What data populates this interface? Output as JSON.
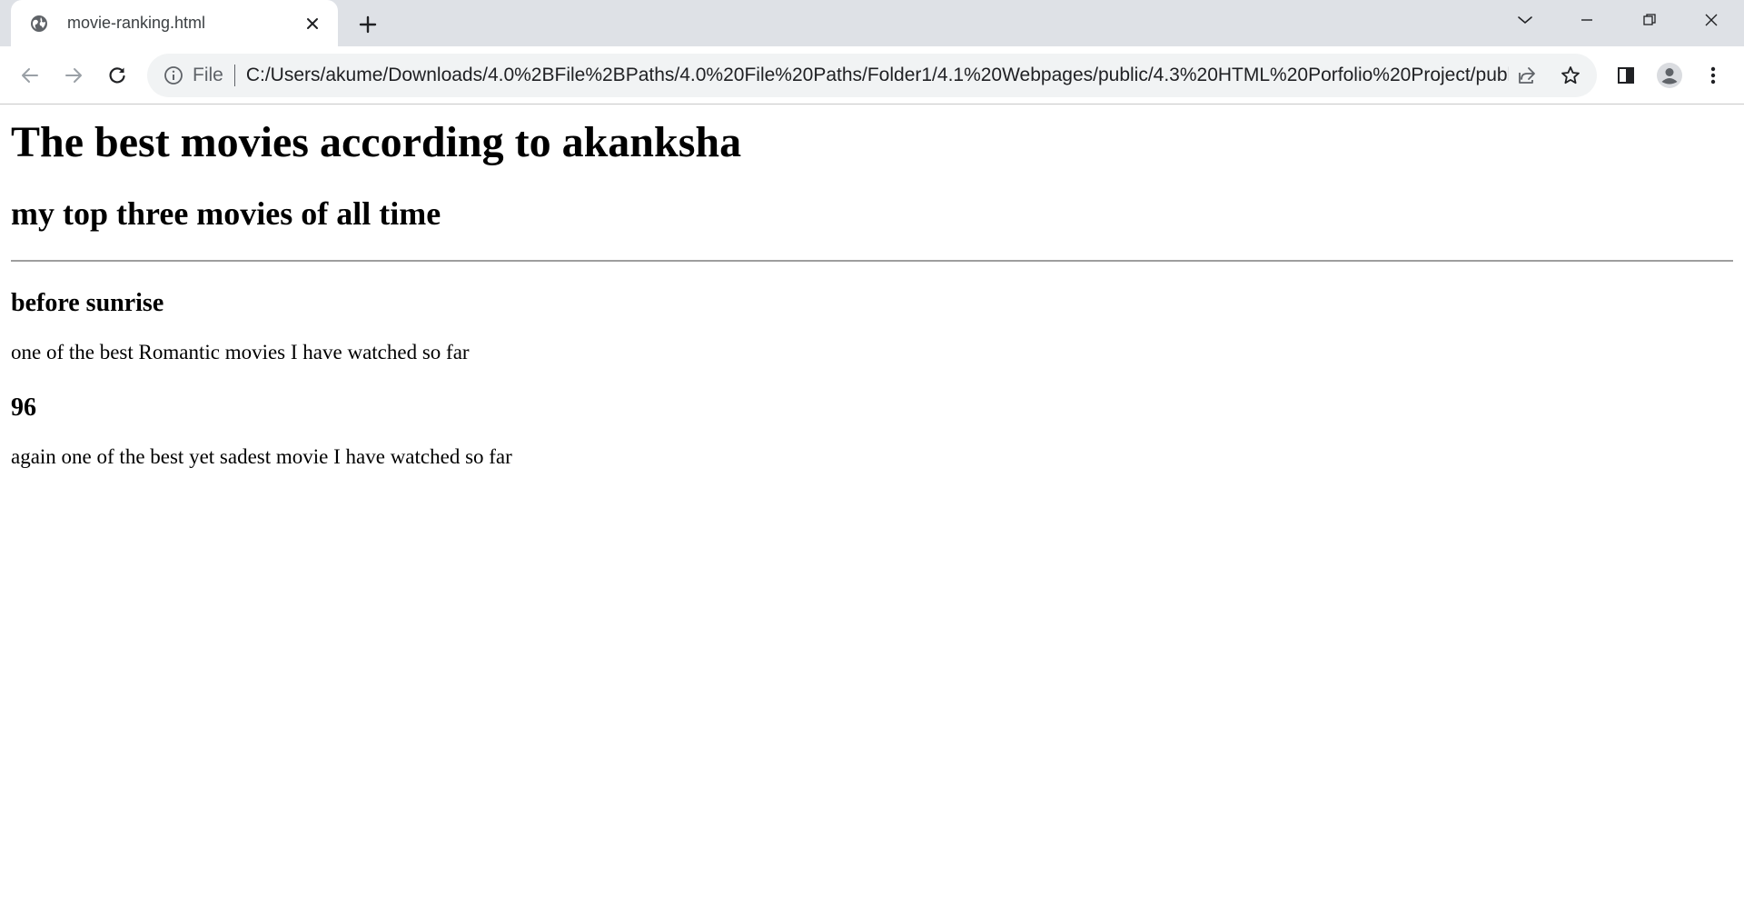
{
  "tab": {
    "title": "movie-ranking.html",
    "favicon": "globe-icon"
  },
  "omnibox": {
    "scheme_label": "File",
    "url": "C:/Users/akume/Downloads/4.0%2BFile%2BPaths/4.0%20File%20Paths/Folder1/4.1%20Webpages/public/4.3%20HTML%20Porfolio%20Project/publi..."
  },
  "page": {
    "heading": "The best movies according to akanksha",
    "subheading": "my top three movies of all time",
    "movies": [
      {
        "title": "before sunrise",
        "description": "one of the best Romantic movies I have watched so far"
      },
      {
        "title": "96",
        "description": "again one of the best yet sadest movie I have watched so far"
      }
    ]
  },
  "colors": {
    "tabstrip": "#dee1e6",
    "omnibox": "#f1f3f4",
    "icon": "#5f6368",
    "text": "#000000"
  }
}
